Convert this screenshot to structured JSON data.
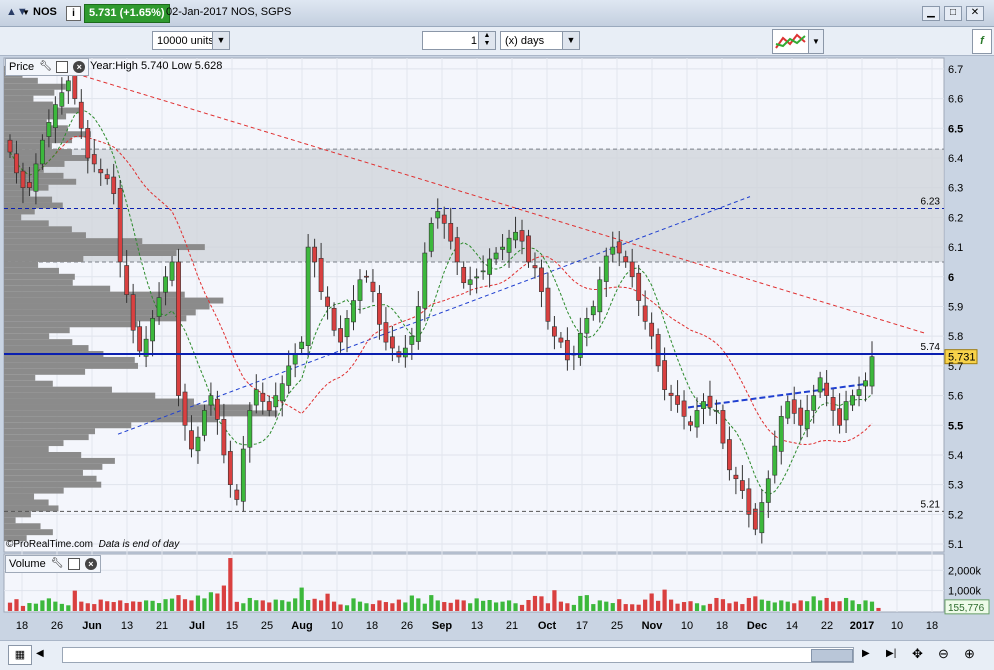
{
  "header": {
    "symbol": "NOS",
    "last": "5.731 (+1.65%)",
    "date_info": "02-Jan-2017 NOS, SGPS"
  },
  "toolbar": {
    "units": "10000 units",
    "period_count": "1",
    "period_unit": "(x) days"
  },
  "price_panel": {
    "label": "Price",
    "ohlc": "Year:High 5.740 Low 5.628",
    "y_ticks": [
      "6.7",
      "6.6",
      "6.5",
      "6.4",
      "6.3",
      "6.2",
      "6.1",
      "6",
      "5.9",
      "5.8",
      "5.7",
      "5.6",
      "5.5",
      "5.4",
      "5.3",
      "5.2",
      "5.1"
    ],
    "level_labels": {
      "high": "6.23",
      "mid": "5.74",
      "low": "5.21"
    },
    "last_price_badge": "5.731",
    "footer": "©ProRealTime.com",
    "footer_note": "Data is end of day"
  },
  "volume_panel": {
    "label": "Volume",
    "y_ticks": [
      "2,000k",
      "1,000k"
    ],
    "last_badge": "155,776"
  },
  "x_axis": {
    "labels": [
      {
        "t": "18",
        "b": false
      },
      {
        "t": "26",
        "b": false
      },
      {
        "t": "Jun",
        "b": true
      },
      {
        "t": "13",
        "b": false
      },
      {
        "t": "21",
        "b": false
      },
      {
        "t": "Jul",
        "b": true
      },
      {
        "t": "15",
        "b": false
      },
      {
        "t": "25",
        "b": false
      },
      {
        "t": "Aug",
        "b": true
      },
      {
        "t": "10",
        "b": false
      },
      {
        "t": "18",
        "b": false
      },
      {
        "t": "26",
        "b": false
      },
      {
        "t": "Sep",
        "b": true
      },
      {
        "t": "13",
        "b": false
      },
      {
        "t": "21",
        "b": false
      },
      {
        "t": "Oct",
        "b": true
      },
      {
        "t": "17",
        "b": false
      },
      {
        "t": "25",
        "b": false
      },
      {
        "t": "Nov",
        "b": true
      },
      {
        "t": "10",
        "b": false
      },
      {
        "t": "18",
        "b": false
      },
      {
        "t": "Dec",
        "b": true
      },
      {
        "t": "14",
        "b": false
      },
      {
        "t": "22",
        "b": false
      },
      {
        "t": "2017",
        "b": true
      },
      {
        "t": "10",
        "b": false
      },
      {
        "t": "18",
        "b": false
      }
    ]
  },
  "colors": {
    "up": "#3cb83c",
    "down": "#d94040",
    "level": "#0a1fb0",
    "trend_red": "#e03030",
    "trend_blue": "#2040d0",
    "zone": "#cfd3d9",
    "plot_bg": "#f4f6fc"
  },
  "icons": [
    "dropdown-arrow-icon",
    "info-icon",
    "wrench-icon",
    "window-icon",
    "close-icon",
    "minimize-icon",
    "maximize-icon",
    "scroll-left-icon",
    "scroll-right-icon",
    "zoom-out-icon",
    "zoom-in-icon",
    "cursor-icon",
    "indicator-icon"
  ],
  "chart_data": {
    "type": "candlestick",
    "title": "NOS",
    "y_range": [
      5.08,
      6.73
    ],
    "series": [
      {
        "name": "price",
        "close": [
          6.42,
          6.35,
          6.3,
          6.3,
          6.38,
          6.46,
          6.52,
          6.58,
          6.62,
          6.66,
          6.6,
          6.5,
          6.4,
          6.38,
          6.35,
          6.33,
          6.28,
          6.05,
          5.94,
          5.82,
          5.75,
          5.79,
          5.86,
          5.93,
          6.0,
          6.05,
          5.6,
          5.5,
          5.42,
          5.46,
          5.55,
          5.6,
          5.52,
          5.4,
          5.3,
          5.25,
          5.42,
          5.55,
          5.62,
          5.58,
          5.55,
          5.6,
          5.64,
          5.7,
          5.74,
          5.78,
          6.1,
          6.05,
          5.95,
          5.9,
          5.82,
          5.78,
          5.86,
          5.92,
          5.99,
          6.0,
          5.95,
          5.84,
          5.78,
          5.76,
          5.73,
          5.76,
          5.8,
          5.9,
          6.08,
          6.18,
          6.22,
          6.18,
          6.12,
          6.05,
          5.98,
          5.99,
          6.0,
          6.02,
          6.06,
          6.08,
          6.1,
          6.13,
          6.15,
          6.12,
          6.05,
          6.03,
          5.95,
          5.85,
          5.8,
          5.78,
          5.72,
          5.74,
          5.81,
          5.86,
          5.9,
          5.99,
          6.07,
          6.1,
          6.08,
          6.05,
          6.0,
          5.92,
          5.85,
          5.8,
          5.7,
          5.62,
          5.6,
          5.57,
          5.53,
          5.5,
          5.55,
          5.58,
          5.56,
          5.55,
          5.44,
          5.35,
          5.32,
          5.28,
          5.2,
          5.15,
          5.24,
          5.32,
          5.43,
          5.53,
          5.58,
          5.54,
          5.5,
          5.55,
          5.6,
          5.66,
          5.6,
          5.55,
          5.5,
          5.58,
          5.6,
          5.62,
          5.65,
          5.731
        ]
      },
      {
        "name": "volume",
        "values": [
          410,
          580,
          250,
          390,
          360,
          520,
          620,
          460,
          350,
          280,
          1000,
          460,
          380,
          340,
          560,
          480,
          440,
          520,
          390,
          470,
          450,
          520,
          500,
          390,
          580,
          610,
          780,
          580,
          520,
          760,
          620,
          920,
          860,
          1250,
          2600,
          450,
          380,
          640,
          530,
          520,
          420,
          560,
          530,
          460,
          620,
          1150,
          540,
          600,
          520,
          850,
          460,
          320,
          280,
          620,
          460,
          380,
          340,
          520,
          440,
          380,
          560,
          420,
          760,
          620,
          360,
          780,
          520,
          440,
          400,
          560,
          520,
          380,
          620,
          500,
          540,
          420,
          460,
          520,
          380,
          300,
          540,
          740,
          720,
          380,
          1020,
          460,
          380,
          300,
          740,
          780,
          340,
          520,
          460,
          390,
          580,
          340,
          330,
          310,
          560,
          860,
          500,
          1050,
          560,
          360,
          440,
          480,
          380,
          280,
          350,
          640,
          580,
          380,
          460,
          340,
          640,
          720,
          560,
          500,
          420,
          520,
          460,
          380,
          520,
          480,
          720,
          520,
          640,
          460,
          480,
          640,
          520,
          340,
          520,
          460,
          150
        ]
      }
    ]
  }
}
